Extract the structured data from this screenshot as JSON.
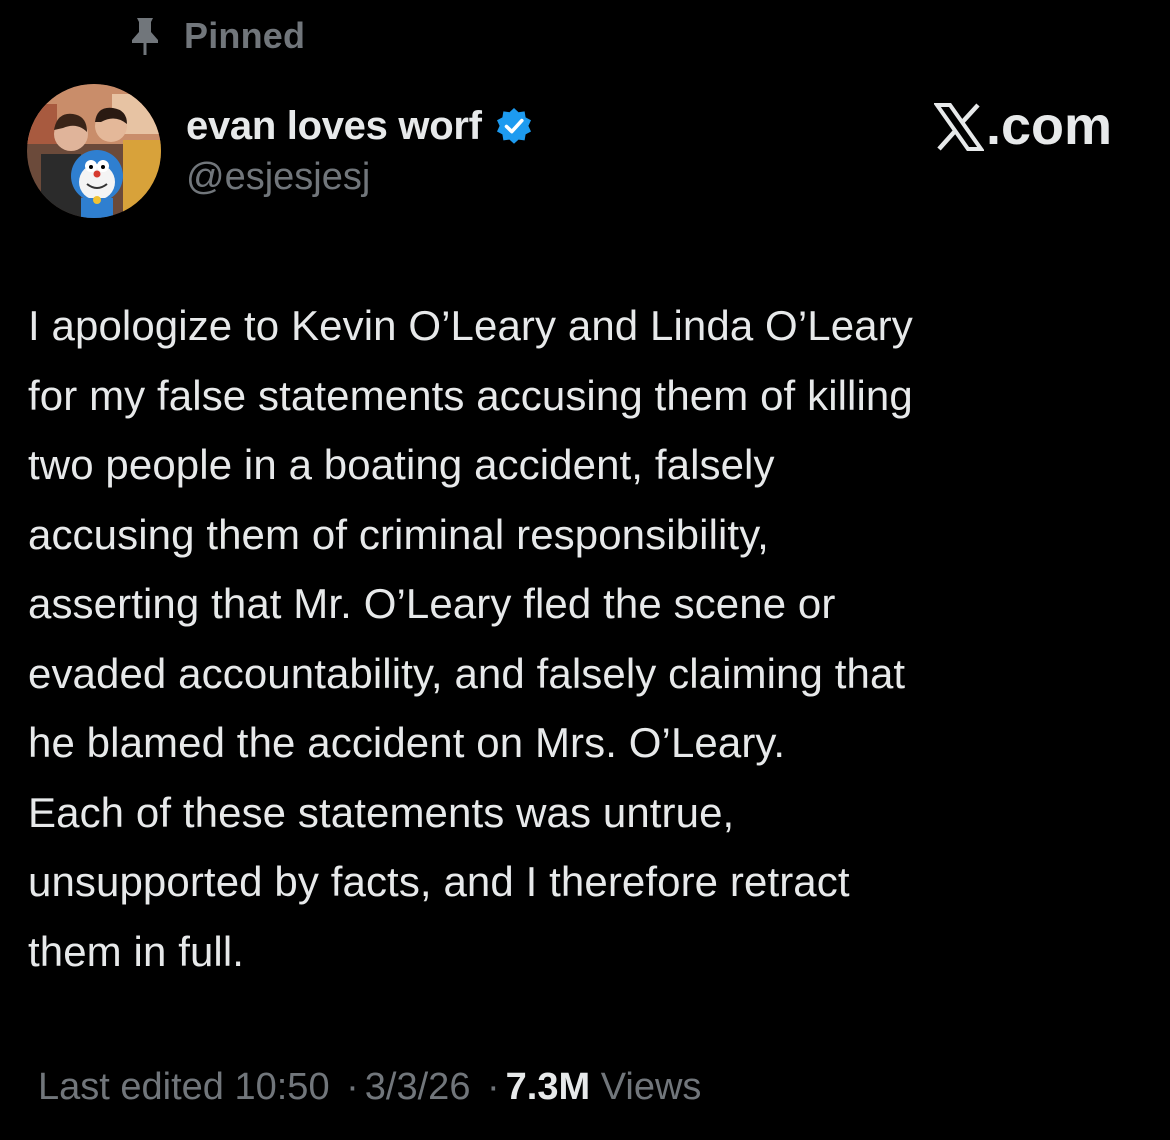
{
  "pinned": {
    "label": "Pinned",
    "icon": "pin-icon"
  },
  "author": {
    "display_name": "evan loves worf",
    "handle": "@esjesjesj",
    "verified": true,
    "verified_color": "#1d9bf0",
    "avatar": "profile-photo"
  },
  "brand": {
    "logo": "x-logo-icon",
    "text": ".com"
  },
  "post": {
    "lines": [
      "I apologize to Kevin O’Leary and Linda O’Leary",
      "for my false statements accusing them of killing",
      "two people in a boating accident, falsely",
      "accusing them of criminal responsibility,",
      "asserting that Mr. O’Leary fled the scene or",
      "evaded accountability, and falsely claiming that",
      "he blamed the accident on Mrs. O’Leary.",
      "Each of these statements was untrue,",
      "unsupported by facts, and I therefore retract",
      "them in full."
    ]
  },
  "meta": {
    "edited_label": "Last edited",
    "time": "10:50",
    "separator": "·",
    "date": "3/3/26",
    "views_count": "7.3M",
    "views_label": "Views"
  },
  "colors": {
    "background": "#000000",
    "primary_text": "#e7e9ea",
    "secondary_text": "#71767b"
  }
}
